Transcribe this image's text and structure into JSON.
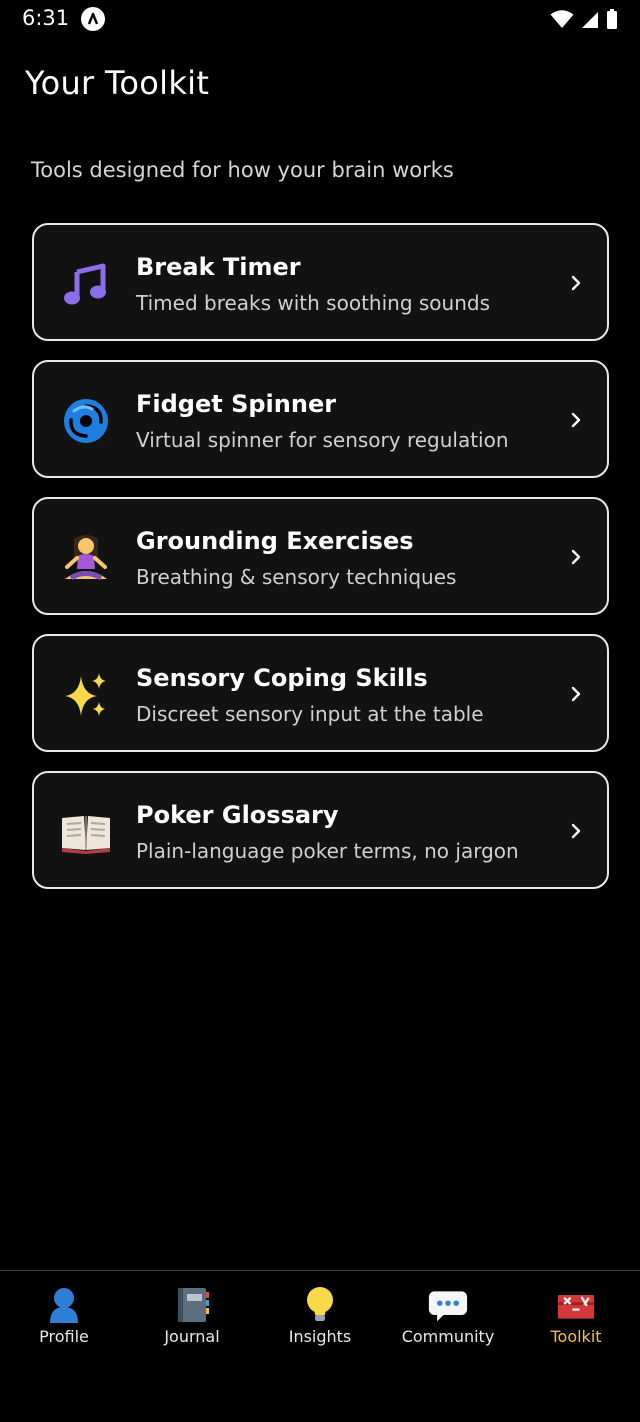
{
  "status_bar": {
    "time": "6:31"
  },
  "header": {
    "title": "Your Toolkit",
    "subtitle": "Tools designed for how your brain works"
  },
  "tools": [
    {
      "title": "Break Timer",
      "description": "Timed breaks with soothing sounds",
      "icon": "music-note-icon"
    },
    {
      "title": "Fidget Spinner",
      "description": "Virtual spinner for sensory regulation",
      "icon": "cyclone-icon"
    },
    {
      "title": "Grounding Exercises",
      "description": "Breathing & sensory techniques",
      "icon": "meditation-icon"
    },
    {
      "title": "Sensory Coping Skills",
      "description": "Discreet sensory input at the table",
      "icon": "sparkles-icon"
    },
    {
      "title": "Poker Glossary",
      "description": "Plain-language poker terms, no jargon",
      "icon": "open-book-icon"
    }
  ],
  "bottom_nav": {
    "items": [
      {
        "label": "Profile",
        "icon": "profile-icon"
      },
      {
        "label": "Journal",
        "icon": "notebook-icon"
      },
      {
        "label": "Insights",
        "icon": "lightbulb-icon"
      },
      {
        "label": "Community",
        "icon": "speech-bubble-icon"
      },
      {
        "label": "Toolkit",
        "icon": "toolbox-icon"
      }
    ],
    "active_index": 4
  },
  "colors": {
    "background": "#000000",
    "card_background": "#121212",
    "card_border": "#e8e8e8",
    "active_nav": "#f4c13a"
  }
}
